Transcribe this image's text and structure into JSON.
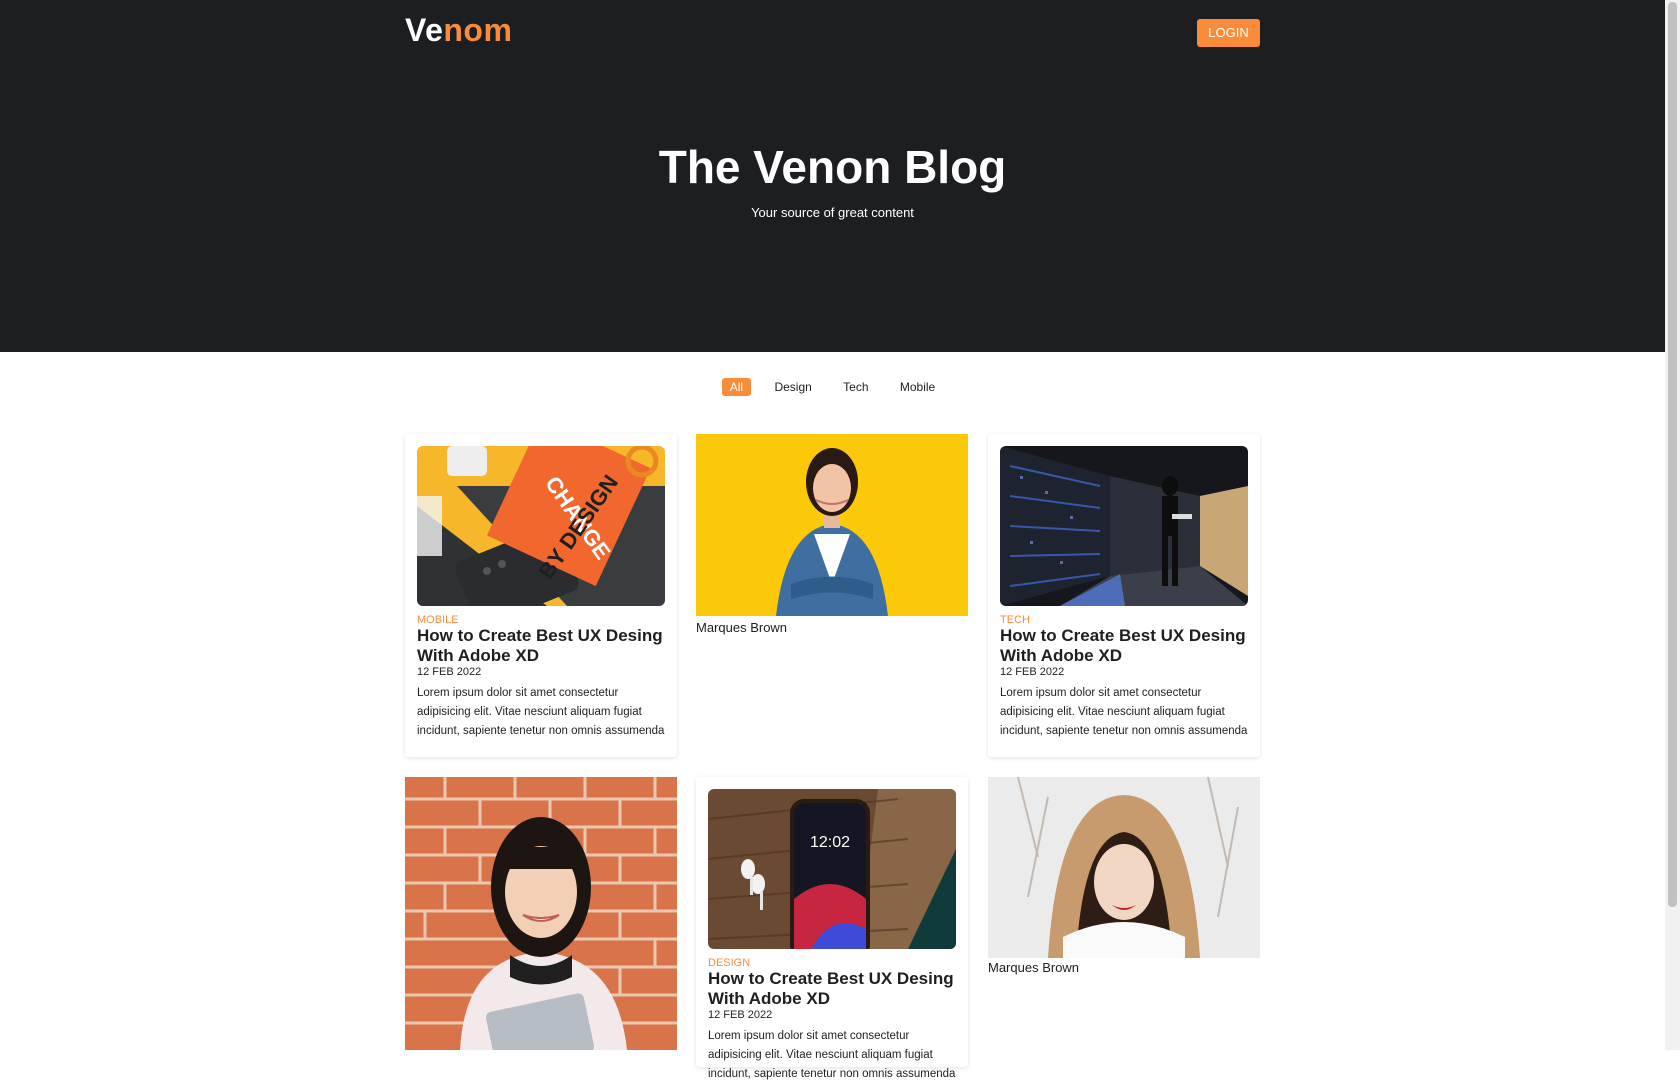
{
  "header": {
    "logo_part1": "Ve",
    "logo_part2": "nom",
    "login_label": "LOGIN"
  },
  "hero": {
    "title": "The Venon Blog",
    "subtitle": "Your source of great content"
  },
  "filters": [
    "All",
    "Design",
    "Tech",
    "Mobile"
  ],
  "active_filter": "All",
  "posts": [
    {
      "category": "MOBILE",
      "title": "How to Create Best UX Desing With Adobe XD",
      "date": "12 FEB 2022",
      "excerpt_lines": [
        "Lorem ipsum dolor sit amet consectetur",
        "adipisicing elit. Vitae nesciunt aliquam fugiat",
        "incidunt, sapiente tenetur non omnis assumenda"
      ]
    },
    {
      "category": "TECH",
      "title": "How to Create Best UX Desing With Adobe XD",
      "date": "12 FEB 2022",
      "excerpt_lines": [
        "Lorem ipsum dolor sit amet consectetur",
        "adipisicing elit. Vitae nesciunt aliquam fugiat",
        "incidunt, sapiente tenetur non omnis assumenda"
      ]
    },
    {
      "category": "DESIGN",
      "title": "How to Create Best UX Desing With Adobe XD",
      "date": "12 FEB 2022",
      "excerpt_lines": [
        "Lorem ipsum dolor sit amet consectetur",
        "adipisicing elit. Vitae nesciunt aliquam fugiat",
        "incidunt, sapiente tenetur non omnis assumenda"
      ]
    }
  ],
  "profiles": [
    {
      "name": "Marques Brown"
    },
    {
      "name": "Marques Brown"
    }
  ],
  "colors": {
    "accent": "#f88c3a",
    "hero_bg": "#1c1e21"
  }
}
